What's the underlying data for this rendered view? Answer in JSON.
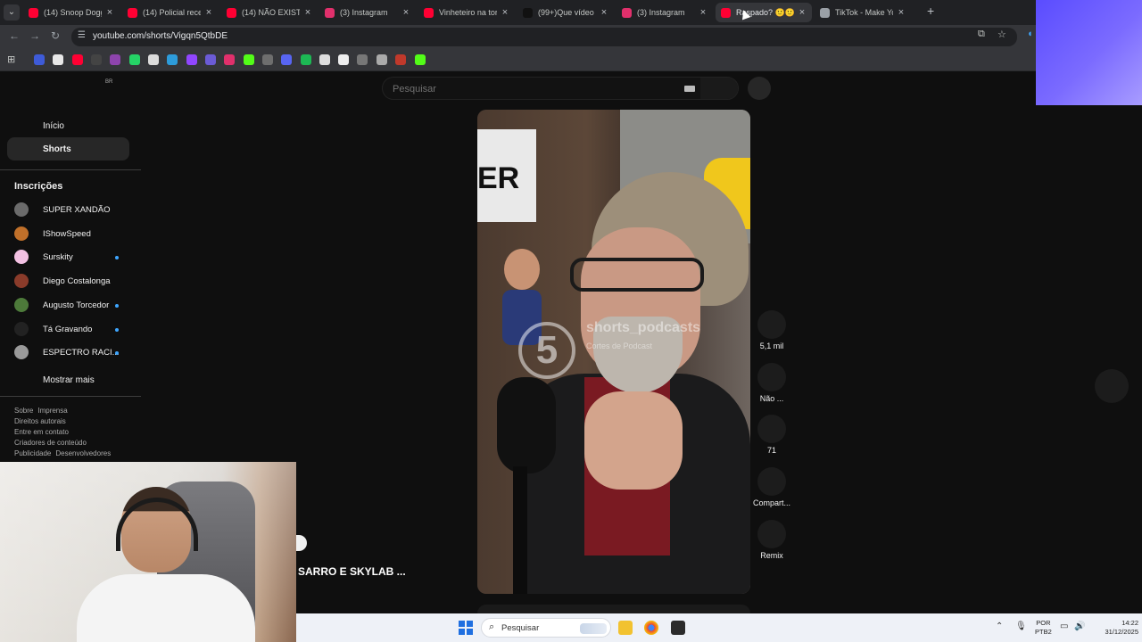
{
  "browser": {
    "tabs": [
      {
        "title": "(14) Snoop Dogg,",
        "color": "#ff0033"
      },
      {
        "title": "(14) Policial receb",
        "color": "#ff0033"
      },
      {
        "title": "(14) NÃO EXISTIR",
        "color": "#ff0033"
      },
      {
        "title": "(3) Instagram",
        "color": "#e1306c"
      },
      {
        "title": "Vinheteiro na tor",
        "color": "#ff0033"
      },
      {
        "title": "(99+)Que vídeo F",
        "color": "#111111"
      },
      {
        "title": "(3) Instagram",
        "color": "#e1306c"
      },
      {
        "title": "Raspado? 🙂🙂",
        "color": "#ff0033"
      },
      {
        "title": "TikTok - Make You",
        "color": "#9aa0a6"
      }
    ],
    "active_tab_index": 7,
    "url": "youtube.com/shorts/Vigqn5QtbDE",
    "icons": {
      "back": "arrow-left-icon",
      "forward": "arrow-right-icon",
      "reload": "reload-icon",
      "star": "star-icon",
      "install": "install-icon"
    }
  },
  "youtube": {
    "country": "BR",
    "search_placeholder": "Pesquisar",
    "nav": [
      {
        "label": "Início",
        "active": false
      },
      {
        "label": "Shorts",
        "active": true
      }
    ],
    "subscriptions_title": "Inscrições",
    "subscriptions": [
      {
        "name": "SUPER XANDÃO",
        "dot": false,
        "color": "#6b6b6b"
      },
      {
        "name": "IShowSpeed",
        "dot": false,
        "color": "#c0702a"
      },
      {
        "name": "Surskity",
        "dot": true,
        "color": "#f3c1e3"
      },
      {
        "name": "Diego Costalonga",
        "dot": false,
        "color": "#8a3b2a"
      },
      {
        "name": "Augusto Torcedor",
        "dot": true,
        "color": "#4d7a3a"
      },
      {
        "name": "Tá Gravando",
        "dot": true,
        "color": "#222222"
      },
      {
        "name": "ESPECTRO RACI...",
        "dot": true,
        "color": "#9a9a9a"
      }
    ],
    "show_more": "Mostrar mais",
    "footer_links": [
      [
        "Sobre",
        "Imprensa"
      ],
      [
        "Direitos autorais"
      ],
      [
        "Entre em contato"
      ],
      [
        "Criadores de conteúdo"
      ],
      [
        "Publicidade",
        "Desenvolvedores"
      ]
    ],
    "short": {
      "title": "SARRO E SKYLAB ...",
      "watermark": "shorts_podcasts",
      "watermark_sub": "Cortes de Podcast",
      "logo_number": "5",
      "sign_text": "ER",
      "actions": [
        {
          "label": "5,1 mil",
          "icon": "like-icon"
        },
        {
          "label": "Não ...",
          "icon": "dislike-icon"
        },
        {
          "label": "71",
          "icon": "comment-icon"
        },
        {
          "label": "Compart...",
          "icon": "share-icon"
        },
        {
          "label": "Remix",
          "icon": "remix-icon"
        }
      ]
    }
  },
  "taskbar": {
    "search_label": "Pesquisar",
    "lang_line1": "POR",
    "lang_line2": "PTB2",
    "time": "14:22",
    "date": "31/12/2025",
    "accent": "#1f6fe0"
  }
}
